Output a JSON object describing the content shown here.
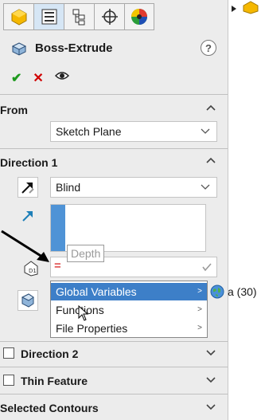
{
  "tabs": [
    {
      "name": "featuremanager-icon"
    },
    {
      "name": "propertymanager-icon"
    },
    {
      "name": "configurationmanager-icon"
    },
    {
      "name": "dimxpertmanager-icon"
    },
    {
      "name": "displaymanager-icon"
    }
  ],
  "header": {
    "title": "Boss-Extrude",
    "help": "?"
  },
  "actions": {
    "ok": "✔",
    "cancel": "✕",
    "preview": "👁"
  },
  "from": {
    "title": "From",
    "value": "Sketch Plane"
  },
  "direction1": {
    "title": "Direction 1",
    "end_condition": "Blind",
    "depth_tip": "Depth",
    "equation_prefix": "="
  },
  "popup": {
    "items": [
      {
        "label": "Global Variables",
        "highlighted": true,
        "arrow": ">"
      },
      {
        "label": "Functions",
        "arrow": ">"
      },
      {
        "label": "File Properties",
        "arrow": ">"
      }
    ],
    "submenu_item": "a (30)"
  },
  "direction2": {
    "title": "Direction 2"
  },
  "thin_feature": {
    "title": "Thin Feature"
  },
  "selected_contours": {
    "title": "Selected Contours"
  },
  "colors": {
    "accent": "#3d7fc8",
    "ok": "#1e9a1e",
    "cancel": "#d00000",
    "annotation": "#000000"
  }
}
